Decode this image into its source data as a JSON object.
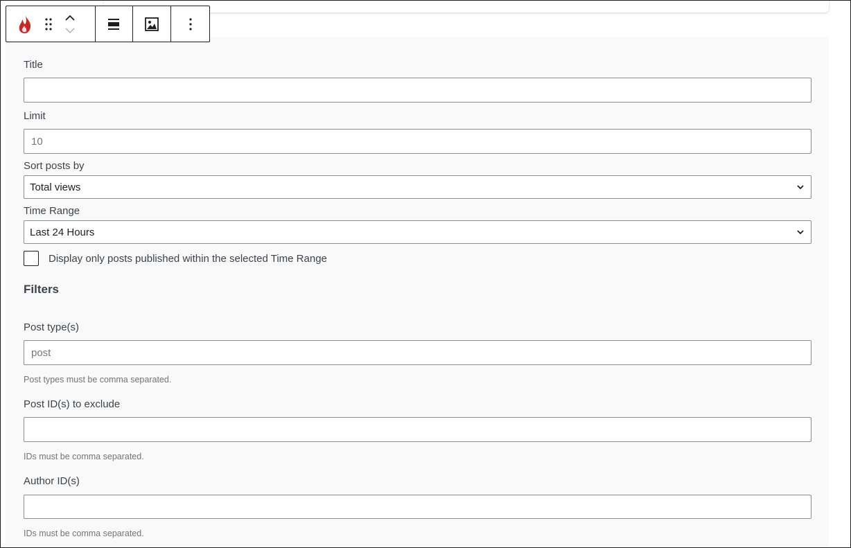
{
  "toolbar": {
    "icons": {
      "block": "flame-icon",
      "drag": "drag-handle-icon",
      "move_up": "chevron-up-icon",
      "move_down": "chevron-down-icon",
      "align": "align-wide-icon",
      "image": "image-icon",
      "more": "more-vertical-icon"
    },
    "colors": {
      "flame": "#c62828",
      "border": "#1e1e1e"
    }
  },
  "form": {
    "title": {
      "label": "Title",
      "value": "",
      "placeholder": ""
    },
    "limit": {
      "label": "Limit",
      "value": "",
      "placeholder": "10"
    },
    "sort": {
      "label": "Sort posts by",
      "selected": "Total views"
    },
    "time_range": {
      "label": "Time Range",
      "selected": "Last 24 Hours"
    },
    "published_within": {
      "label": "Display only posts published within the selected Time Range",
      "checked": false
    }
  },
  "filters": {
    "heading": "Filters",
    "post_types": {
      "label": "Post type(s)",
      "value": "",
      "placeholder": "post",
      "help": "Post types must be comma separated."
    },
    "exclude_ids": {
      "label": "Post ID(s) to exclude",
      "value": "",
      "placeholder": "",
      "help": "IDs must be comma separated."
    },
    "author_ids": {
      "label": "Author ID(s)",
      "value": "",
      "placeholder": "",
      "help": "IDs must be comma separated."
    }
  }
}
